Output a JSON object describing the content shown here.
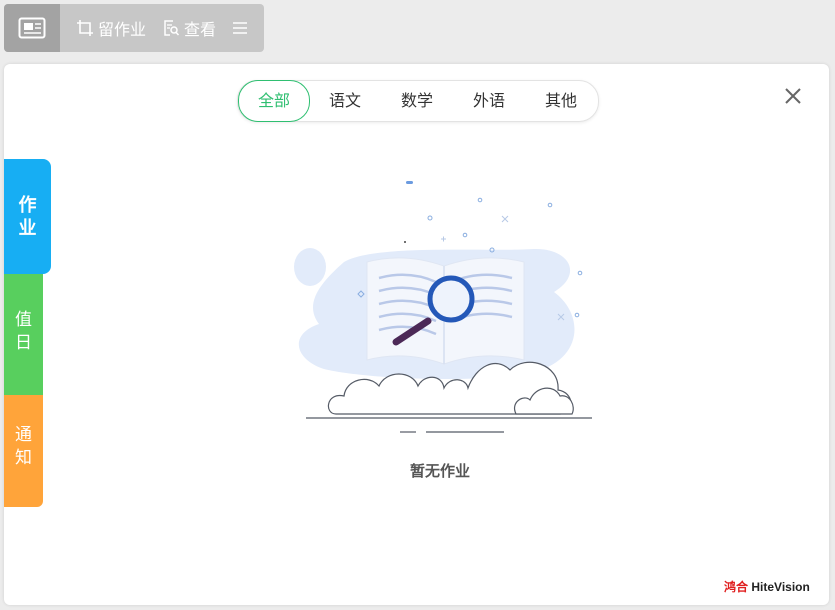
{
  "toolbar": {
    "assign_label": "留作业",
    "view_label": "查看"
  },
  "tabs": [
    {
      "label": "全部",
      "active": true
    },
    {
      "label": "语文",
      "active": false
    },
    {
      "label": "数学",
      "active": false
    },
    {
      "label": "外语",
      "active": false
    },
    {
      "label": "其他",
      "active": false
    }
  ],
  "side_tabs": {
    "homework": [
      "作",
      "业"
    ],
    "duty": [
      "值",
      "日"
    ],
    "notice": [
      "通",
      "知"
    ]
  },
  "empty_state": {
    "message": "暂无作业",
    "icon": "empty-book-magnifier-illustration"
  },
  "brand": {
    "logo_mark": "鸿合",
    "name": "HiteVision"
  },
  "colors": {
    "accent_green": "#2fbf71",
    "homework_blue": "#17aef3",
    "duty_green": "#58cf5e",
    "notice_orange": "#ffa43a",
    "toolbar_gray": "#c7c7c7"
  }
}
